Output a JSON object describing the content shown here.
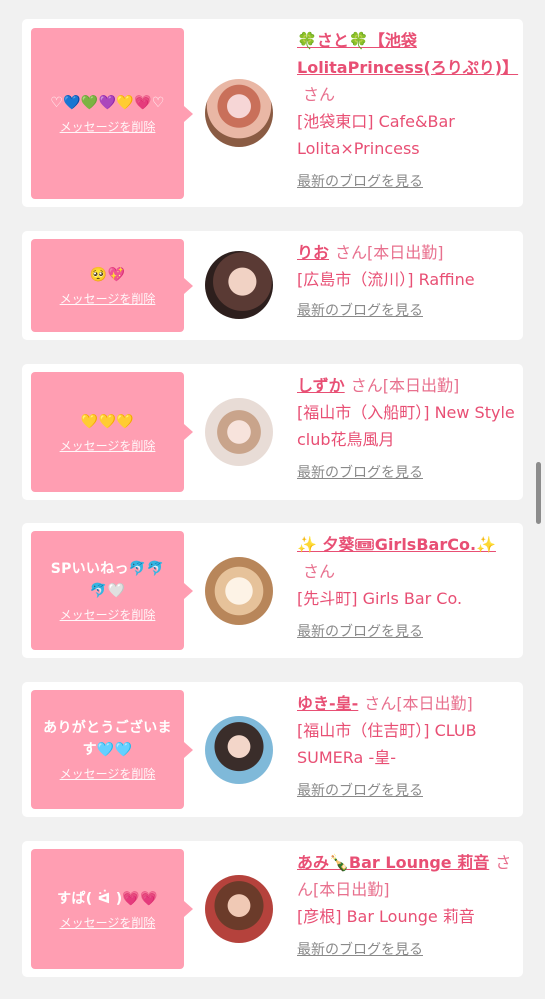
{
  "messages": [
    {
      "bubble_text": "♡💙💚💜💛💗♡",
      "delete_label": "メッセージを削除",
      "name": "🍀さと🍀【池袋LolitaPrincess(ろりぷり)】",
      "san": "さん",
      "status": "",
      "shop": "[池袋東口] Cafe&Bar Lolita×Princess",
      "blog_label": "最新のブログを見る"
    },
    {
      "bubble_text": "🥺💖",
      "delete_label": "メッセージを削除",
      "name": "りお",
      "san": "さん",
      "status": "[本日出勤]",
      "shop": "[広島市（流川）] Raffine",
      "blog_label": "最新のブログを見る"
    },
    {
      "bubble_text": "💛💛💛",
      "delete_label": "メッセージを削除",
      "name": "しずか",
      "san": "さん",
      "status": "[本日出勤]",
      "shop": "[福山市（入船町）] New Style club花鳥風月",
      "blog_label": "最新のブログを見る"
    },
    {
      "bubble_text": "SPいいねっ🐬🐬🐬🤍",
      "delete_label": "メッセージを削除",
      "name": "✨ 夕葵🎟GirlsBarCo.✨",
      "san": "さん",
      "status": "",
      "shop": "[先斗町] Girls Bar Co.",
      "blog_label": "最新のブログを見る"
    },
    {
      "bubble_text": "ありがとうございます🩵🩵",
      "delete_label": "メッセージを削除",
      "name": "ゆき-皇-",
      "san": "さん",
      "status": "[本日出勤]",
      "shop": "[福山市（住吉町）] CLUB SUMERa -皇-",
      "blog_label": "最新のブログを見る"
    },
    {
      "bubble_text": "すぱ( ᐛ )💗💗",
      "delete_label": "メッセージを削除",
      "name": "あみ🍾Bar Lounge 莉音",
      "san": "さん",
      "status": "[本日出勤]",
      "shop": "[彦根] Bar Lounge 莉音",
      "blog_label": "最新のブログを見る"
    }
  ],
  "colors": {
    "page_bg": "#f1f1f1",
    "card_bg": "#ffffff",
    "bubble_bg": "#ff9eb2",
    "accent_pink": "#e84f74",
    "link_gray": "#8a8a8a"
  }
}
